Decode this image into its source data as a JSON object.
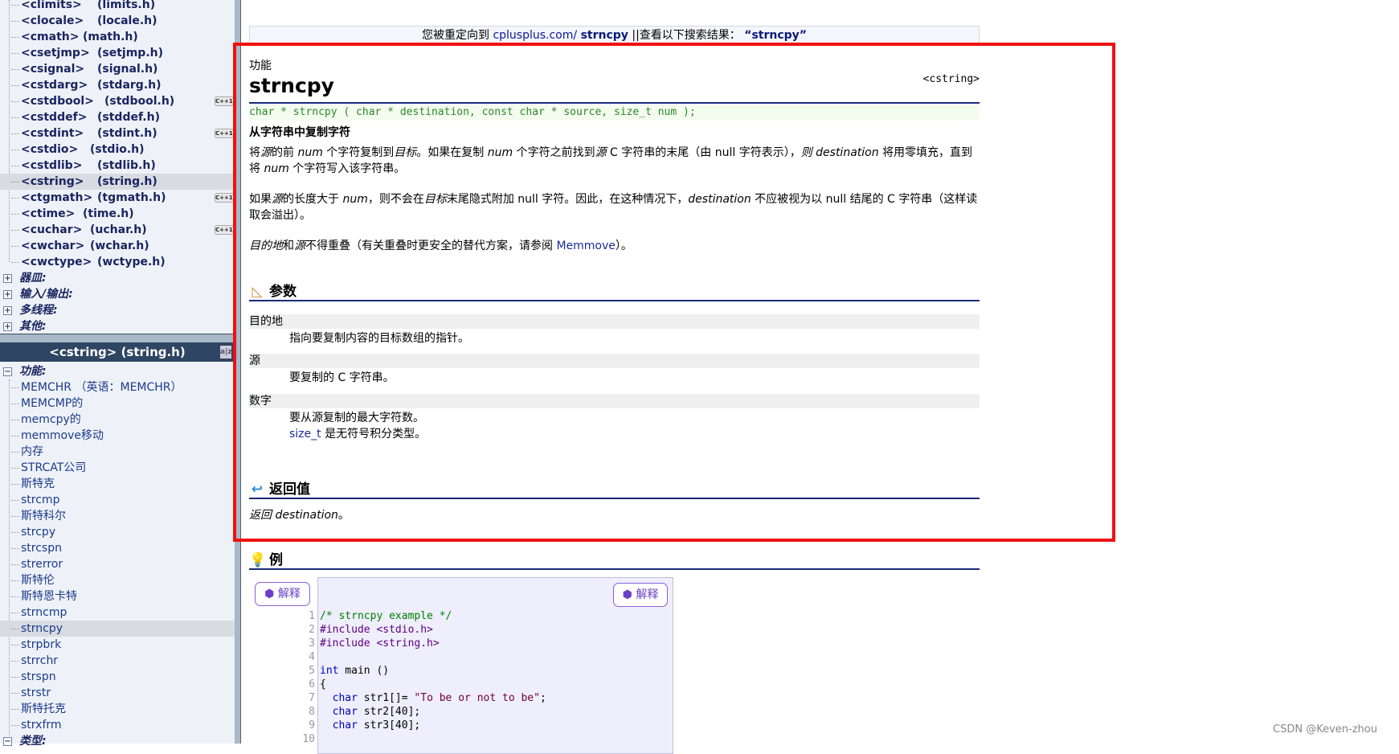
{
  "sidebar": {
    "headers": [
      {
        "name": "<climits>",
        "file": "(limits.h)"
      },
      {
        "name": "<clocale>",
        "file": "(locale.h)"
      },
      {
        "name": "<cmath>",
        "file": "(math.h)"
      },
      {
        "name": "<csetjmp>",
        "file": "(setjmp.h)"
      },
      {
        "name": "<csignal>",
        "file": "(signal.h)"
      },
      {
        "name": "<cstdarg>",
        "file": "(stdarg.h)"
      },
      {
        "name": "<cstdbool>",
        "file": "(stdbool.h)",
        "badge": "C++11"
      },
      {
        "name": "<cstddef>",
        "file": "(stddef.h)"
      },
      {
        "name": "<cstdint>",
        "file": "(stdint.h)",
        "badge": "C++11"
      },
      {
        "name": "<cstdio>",
        "file": "(stdio.h)"
      },
      {
        "name": "<cstdlib>",
        "file": "(stdlib.h)"
      },
      {
        "name": "<cstring>",
        "file": "(string.h)",
        "selected": true
      },
      {
        "name": "<ctgmath>",
        "file": "(tgmath.h)",
        "badge": "C++11"
      },
      {
        "name": "<ctime>",
        "file": "(time.h)"
      },
      {
        "name": "<cuchar>",
        "file": "(uchar.h)",
        "badge": "C++11"
      },
      {
        "name": "<cwchar>",
        "file": "(wchar.h)"
      },
      {
        "name": "<cwctype>",
        "file": "(wctype.h)"
      }
    ],
    "categories": [
      "器皿:",
      "输入/输出:",
      "多线程:",
      "其他:"
    ],
    "panel_title": "<cstring>  (string.h)",
    "panel_sort": "a|z",
    "functions_label": "功能:",
    "functions": [
      "MEMCHR （英语：MEMCHR）",
      "MEMCMP的",
      "memcpy的",
      "memmove移动",
      "内存",
      "STRCAT公司",
      "斯特克",
      "strcmp",
      "斯特科尔",
      "strcpy",
      "strcspn",
      "strerror",
      "斯特伦",
      "斯特恩卡特",
      "strncmp",
      "strncpy",
      "strpbrk",
      "strrchr",
      "strspn",
      "strstr",
      "斯特托克",
      "strxfrm"
    ],
    "selected_function": "strncpy",
    "types_label": "类型:"
  },
  "redirect": {
    "prefix": "您被重定向到 ",
    "link": "cplusplus.com/",
    "term": "strncpy",
    "sep": " ||",
    "search": "查看以下搜索结果：",
    "quoted": "“strncpy”"
  },
  "page": {
    "kind": "功能",
    "title": "strncpy",
    "header": "<cstring>",
    "prototype": "char * strncpy ( char * destination, const char * source, size_t num );",
    "summary": "从字符串中复制字符",
    "p1a": "将",
    "p1b": "源",
    "p1c": "的前 ",
    "p1d": "num",
    "p1e": " 个字符复制到",
    "p1f": "目标",
    "p1g": "。如果在复制 ",
    "p1h": "num",
    "p1i": " 个字符之前找到",
    "p1j": "源",
    "p1k": " C 字符串的末尾（由 null 字符表示），",
    "p1l": "则 destination",
    "p1m": " 将用零填充，直到将 ",
    "p1n": "num",
    "p1o": " 个字符写入该字符串。",
    "p2a": "如果",
    "p2b": "源",
    "p2c": "的长度大于 ",
    "p2d": "num",
    "p2e": "，则不会在",
    "p2f": "目标",
    "p2g": "末尾隐式附加 null 字符。因此，在这种情况下，",
    "p2h": "destination",
    "p2i": " 不应被视为以 null 结尾的 C 字符串（这样读取会溢出）。",
    "p3a": "目的地",
    "p3b": "和",
    "p3c": "源",
    "p3d": "不得重叠（有关重叠时更安全的替代方案，请参阅 ",
    "p3e": "Memmove",
    "p3f": "）。",
    "params_title": "参数",
    "params": [
      {
        "name": "目的地",
        "desc": "指向要复制内容的目标数组的指针。"
      },
      {
        "name": "源",
        "desc": "要复制的 C 字符串。"
      },
      {
        "name": "数字",
        "desc": "要从源复制的最大字符数。",
        "type": "size_t",
        "type_desc": " 是无符号积分类型。"
      }
    ],
    "return_title": "返回值",
    "return_a": "返回 destination",
    "return_b": "。",
    "example_title": "例",
    "explain_label": "解释"
  },
  "code": {
    "line_numbers": [
      "1",
      "2",
      "3",
      "4",
      "5",
      "6",
      "7",
      "8",
      "9",
      "10"
    ],
    "l1": "/* strncpy example */",
    "l2": "#include <stdio.h>",
    "l3": "#include <string.h>",
    "l5a": "int",
    "l5b": " main ()",
    "l6": "{",
    "l7a": "  char",
    "l7b": " str1[]= ",
    "l7c": "\"To be or not to be\"",
    "l7d": ";",
    "l8a": "  char",
    "l8b": " str2[40];",
    "l9a": "  char",
    "l9b": " str3[40];"
  },
  "watermark": "CSDN @Keven-zhou"
}
